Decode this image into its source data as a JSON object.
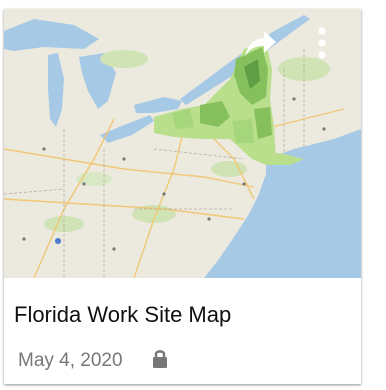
{
  "card": {
    "title": "Florida Work Site Map",
    "date": "May 4, 2020",
    "icons": {
      "share": "share-arrow-icon",
      "more": "more-vertical-icon",
      "lock": "lock-icon"
    },
    "colors": {
      "water": "#a6c9e6",
      "land": "#ece9df",
      "highlight_dark": "#5f9e45",
      "highlight_mid": "#86c05d",
      "highlight_light": "#b9df8d",
      "text_primary": "#111111",
      "text_secondary": "#777777"
    }
  }
}
